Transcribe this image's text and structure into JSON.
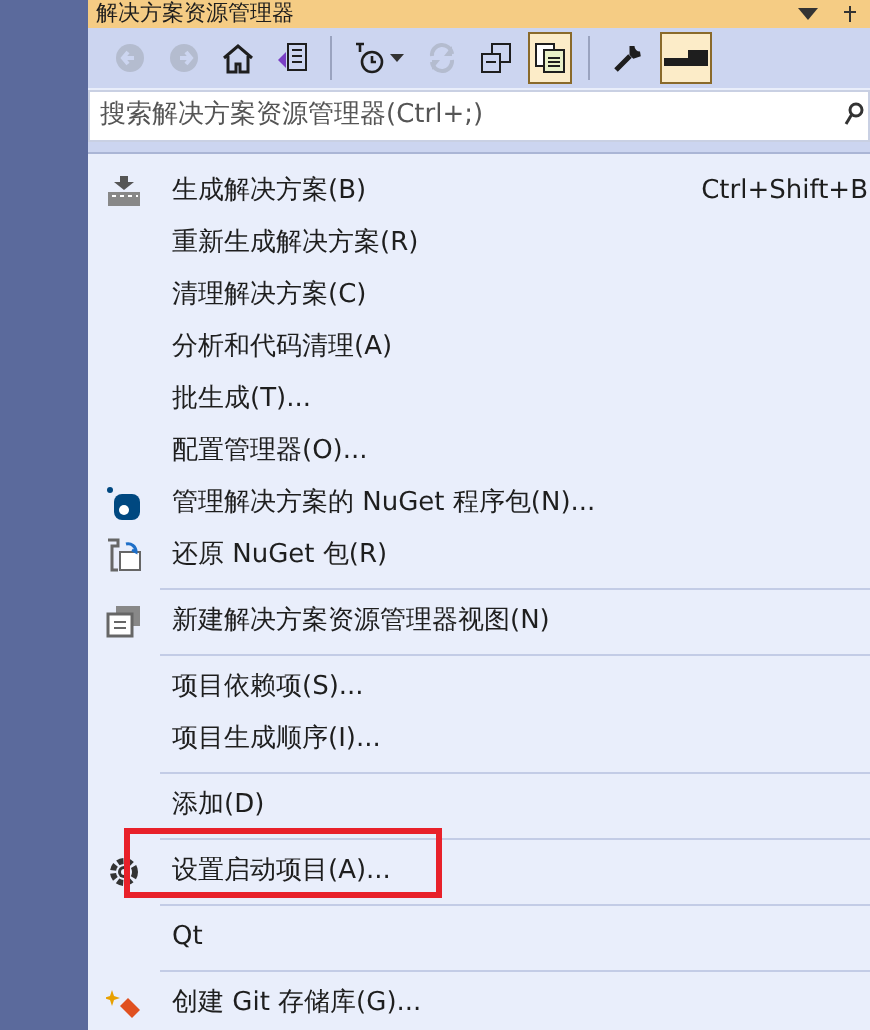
{
  "panel": {
    "title": "解决方案资源管理器"
  },
  "toolbar": [
    {
      "disabled": true,
      "selected": false
    },
    {
      "disabled": true,
      "selected": false
    },
    {
      "disabled": false,
      "selected": false
    },
    {
      "disabled": false,
      "selected": false
    },
    {
      "disabled": false,
      "selected": false
    },
    {
      "disabled": true,
      "selected": false
    },
    {
      "disabled": false,
      "selected": false
    },
    {
      "disabled": false,
      "selected": true
    },
    {
      "disabled": false,
      "selected": false
    },
    {
      "disabled": false,
      "selected": true
    }
  ],
  "search": {
    "placeholder": "搜索解决方案资源管理器(Ctrl+;)"
  },
  "menu": [
    {
      "kind": "item",
      "label": "生成解决方案(B)",
      "shortcut": "Ctrl+Shift+B",
      "highlighted": false
    },
    {
      "kind": "item",
      "label": "重新生成解决方案(R)",
      "highlighted": false
    },
    {
      "kind": "item",
      "label": "清理解决方案(C)",
      "highlighted": false
    },
    {
      "kind": "item",
      "label": "分析和代码清理(A)",
      "highlighted": false
    },
    {
      "kind": "item",
      "label": "批生成(T)...",
      "highlighted": false
    },
    {
      "kind": "item",
      "label": "配置管理器(O)...",
      "highlighted": false
    },
    {
      "kind": "item",
      "label": "管理解决方案的 NuGet 程序包(N)...",
      "highlighted": false
    },
    {
      "kind": "item",
      "label": "还原 NuGet 包(R)",
      "highlighted": false
    },
    {
      "kind": "separator"
    },
    {
      "kind": "item",
      "label": "新建解决方案资源管理器视图(N)",
      "highlighted": false
    },
    {
      "kind": "separator"
    },
    {
      "kind": "item",
      "label": "项目依赖项(S)...",
      "highlighted": false
    },
    {
      "kind": "item",
      "label": "项目生成顺序(I)...",
      "highlighted": false
    },
    {
      "kind": "separator"
    },
    {
      "kind": "item",
      "label": "添加(D)",
      "highlighted": false
    },
    {
      "kind": "separator"
    },
    {
      "kind": "item",
      "label": "设置启动项目(A)...",
      "highlighted": true
    },
    {
      "kind": "separator"
    },
    {
      "kind": "item",
      "label": "Qt",
      "highlighted": false
    },
    {
      "kind": "separator"
    },
    {
      "kind": "item",
      "label": "创建 Git 存储库(G)...",
      "highlighted": false
    }
  ]
}
